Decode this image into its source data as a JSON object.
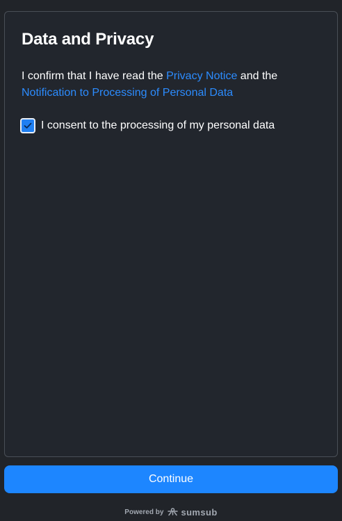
{
  "page": {
    "title": "Data and Privacy"
  },
  "confirm": {
    "prefix": "I confirm that I have read the ",
    "privacy_notice_link": "Privacy Notice",
    "middle": " and the ",
    "notification_link": "Notification to Processing of Personal Data"
  },
  "consent": {
    "label": "I consent to the processing of my personal data",
    "checked": true
  },
  "actions": {
    "continue_label": "Continue"
  },
  "footer": {
    "powered_by": "Powered by",
    "brand": "sumsub",
    "brand_icon": "sumsub-logo-icon"
  },
  "colors": {
    "background": "#212429",
    "link": "#2c8cff",
    "accent": "#1d86ff",
    "panel_border": "#4a4f57"
  }
}
